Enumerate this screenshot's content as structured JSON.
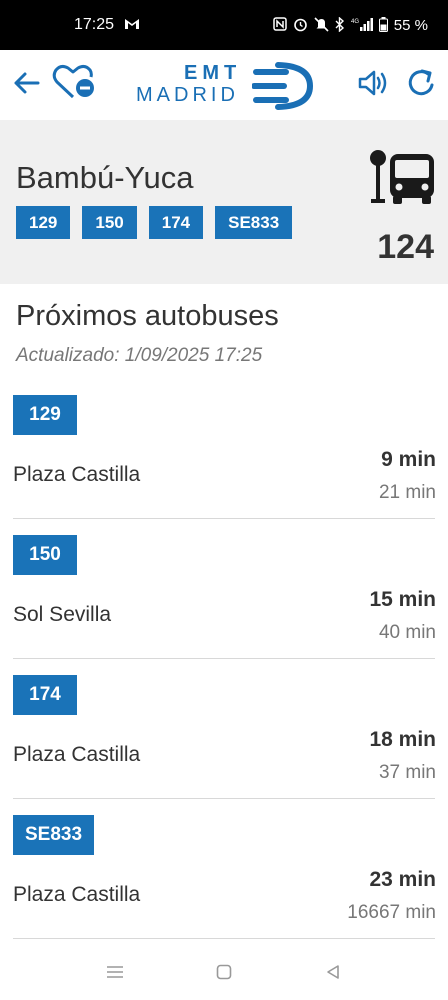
{
  "status_bar": {
    "time": "17:25",
    "mail_icon": "gmail-icon",
    "network": "4G",
    "battery": "55 %"
  },
  "app_bar": {
    "logo_top": "EMT",
    "logo_bottom": "MADRID",
    "brand_color": "#1a6fb5"
  },
  "stop": {
    "name": "Bambú-Yuca",
    "number": "124",
    "lines": [
      "129",
      "150",
      "174",
      "SE833"
    ]
  },
  "section": {
    "title": "Próximos autobuses",
    "updated": "Actualizado: 1/09/2025 17:25"
  },
  "arrivals": [
    {
      "line": "129",
      "destination": "Plaza Castilla",
      "eta": "9 min",
      "eta_next": "21 min"
    },
    {
      "line": "150",
      "destination": "Sol Sevilla",
      "eta": "15 min",
      "eta_next": "40 min"
    },
    {
      "line": "174",
      "destination": "Plaza Castilla",
      "eta": "18 min",
      "eta_next": "37 min"
    },
    {
      "line": "SE833",
      "destination": "Plaza Castilla",
      "eta": "23 min",
      "eta_next": "16667 min"
    }
  ],
  "colors": {
    "accent": "#1a73b8",
    "header_bg": "#f0f0f0",
    "text": "#333333",
    "muted": "#777777"
  }
}
